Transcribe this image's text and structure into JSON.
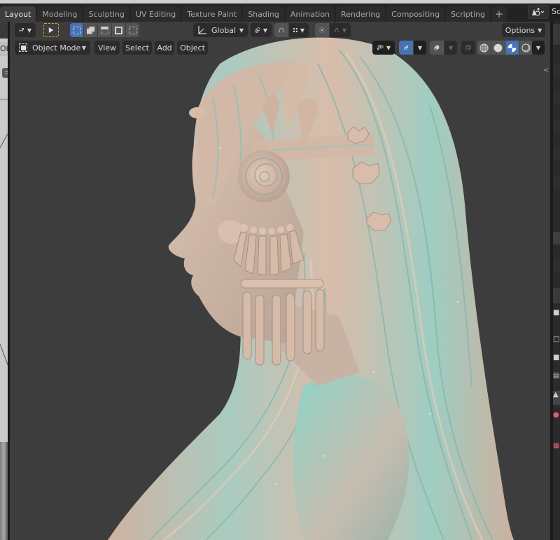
{
  "workspace_tabs": [
    {
      "label": "Layout",
      "active": true
    },
    {
      "label": "Modeling",
      "active": false
    },
    {
      "label": "Sculpting",
      "active": false
    },
    {
      "label": "UV Editing",
      "active": false
    },
    {
      "label": "Texture Paint",
      "active": false
    },
    {
      "label": "Shading",
      "active": false
    },
    {
      "label": "Animation",
      "active": false
    },
    {
      "label": "Rendering",
      "active": false
    },
    {
      "label": "Compositing",
      "active": false
    },
    {
      "label": "Scripting",
      "active": false
    }
  ],
  "add_workspace_label": "+",
  "scene": {
    "label": "Sc",
    "icon": "scene-icon"
  },
  "left_editor": {
    "label": "Obj",
    "toggle_label": ">"
  },
  "toolbar": {
    "transform_pivot_icon": "pivot-icon",
    "select_tool_icon": "cursor-icon",
    "selection_modes": [
      "set",
      "extend",
      "subtract",
      "difference",
      "intersect"
    ],
    "active_selection_mode": "set",
    "orientation_label": "Global",
    "snap_icon": "snap-icon",
    "snap_target_icon": "increment-grid-icon",
    "proportional_icon": "proportional-edit-icon",
    "falloff_icon": "falloff-curve-icon",
    "options_label": "Options"
  },
  "header2": {
    "mode_label": "Object Mode",
    "menus": [
      "View",
      "Select",
      "Add",
      "Object"
    ],
    "visibility_icon": "eye-icon",
    "gizmo_icon": "gizmo-icon",
    "overlay_icon": "overlay-icon",
    "xray_icon": "xray-icon",
    "shading_modes": [
      "wireframe",
      "solid",
      "material-preview",
      "rendered"
    ],
    "active_shading": "material-preview"
  },
  "colors": {
    "accent": "#4772b3",
    "viewport_bg": "#3d3d3d",
    "header_bg": "#232323",
    "active_tool_outline": "#e59e27",
    "model_peach": "#d7b9a5",
    "model_cyan": "#8fc9bd"
  },
  "right_editor": {
    "toggle_label": "<"
  }
}
